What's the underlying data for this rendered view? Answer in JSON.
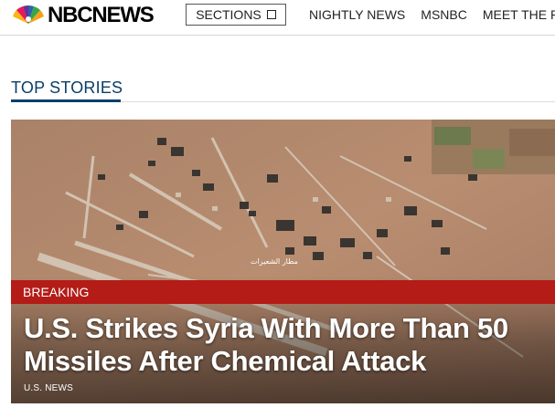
{
  "header": {
    "logo_text": "NBCNEWS",
    "sections_label": "SECTIONS",
    "nav": [
      "NIGHTLY NEWS",
      "MSNBC",
      "MEET THE PR"
    ]
  },
  "top_stories": {
    "heading": "TOP STORIES"
  },
  "hero": {
    "badge": "BREAKING",
    "headline": "U.S. Strikes Syria With More Than 50 Missiles After Chemical Attack",
    "category": "U.S. NEWS",
    "map_label": "مطار الشعيرات"
  },
  "colors": {
    "breaking_red": "#b41c17",
    "heading_blue": "#0b3e68",
    "peacock": [
      "#f7a11b",
      "#e6185a",
      "#6e2f8f",
      "#2b62b0",
      "#37a54a",
      "#fbb514"
    ]
  }
}
